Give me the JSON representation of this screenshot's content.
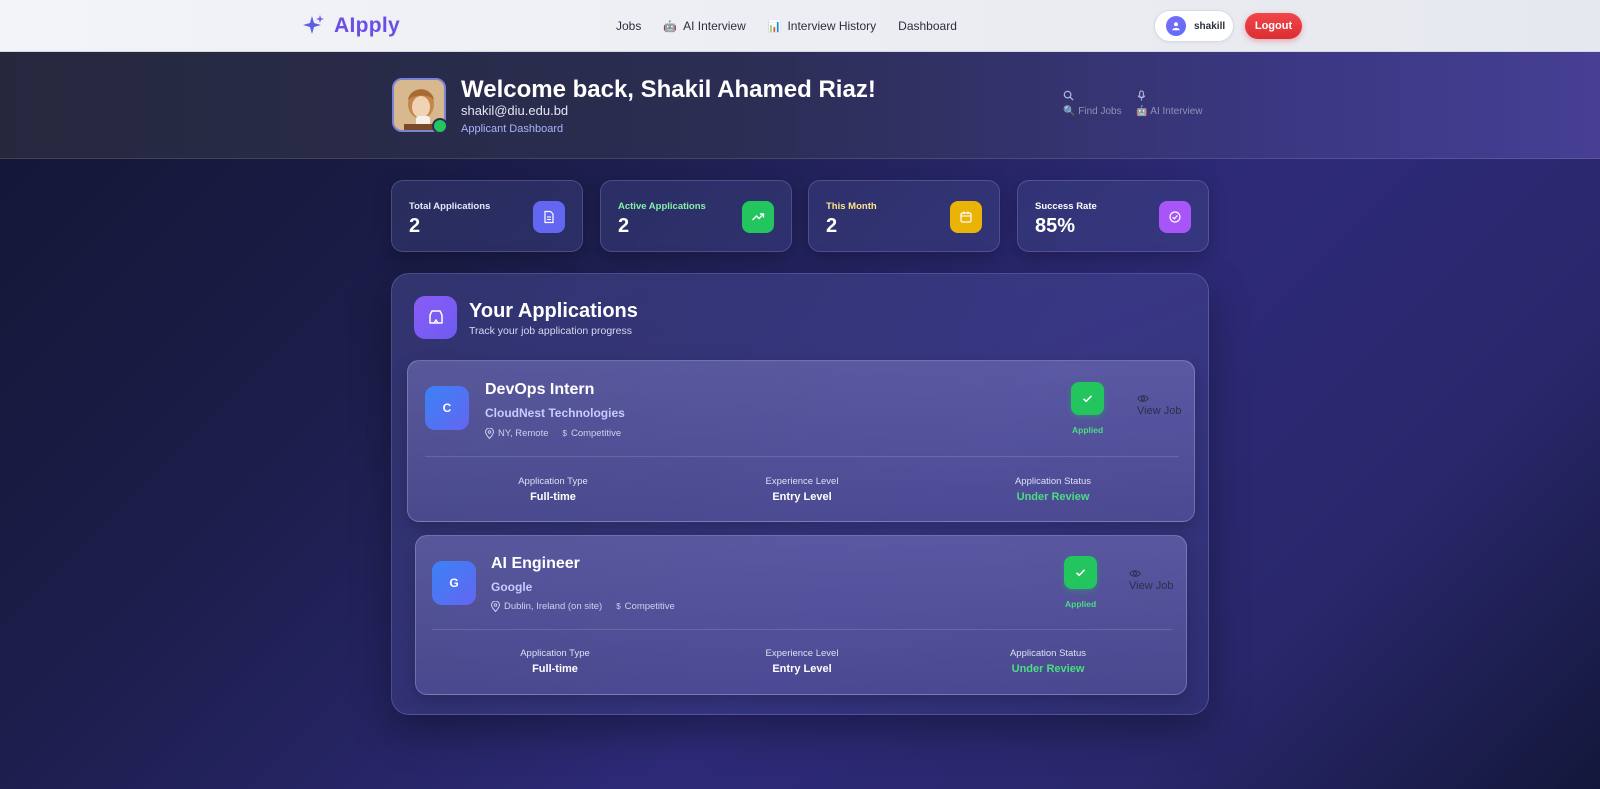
{
  "nav": {
    "brand": "AIpply",
    "links": [
      {
        "label": "Jobs",
        "icon": ""
      },
      {
        "label": "AI Interview",
        "icon": "robot-icon"
      },
      {
        "label": "Interview History",
        "icon": "chart-icon"
      },
      {
        "label": "Dashboard",
        "icon": ""
      }
    ],
    "username": "shakill",
    "logout_label": "Logout"
  },
  "header": {
    "welcome": "Welcome back, Shakil Ahamed Riaz!",
    "email": "shakil@diu.edu.bd",
    "role": "Applicant Dashboard",
    "quick_links": [
      {
        "label": "Find Jobs",
        "icon": "search-icon"
      },
      {
        "label": "AI Interview",
        "icon": "microphone-icon"
      }
    ]
  },
  "stats": [
    {
      "label": "Total Applications",
      "value": "2",
      "color": "#6366f1",
      "label_color": "#e6e8ff",
      "icon": "document-icon"
    },
    {
      "label": "Active Applications",
      "value": "2",
      "color": "#22c55e",
      "label_color": "#86efac",
      "icon": "trending-up-icon"
    },
    {
      "label": "This Month",
      "value": "2",
      "color": "#eab308",
      "label_color": "#fde68a",
      "icon": "calendar-icon"
    },
    {
      "label": "Success Rate",
      "value": "85%",
      "color": "#a855f7",
      "label_color": "#ffffff",
      "icon": "check-circle-icon"
    }
  ],
  "applications_panel": {
    "title": "Your Applications",
    "subtitle": "Track your job application progress",
    "detail_labels": {
      "type": "Application Type",
      "experience": "Experience Level",
      "status": "Application Status"
    },
    "view_label": "View Job",
    "applications": [
      {
        "badge": "C",
        "title": "DevOps Intern",
        "company": "CloudNest Technologies",
        "location": "NY, Remote",
        "salary": "Competitive",
        "status_badge": "Applied",
        "type": "Full-time",
        "experience": "Entry Level",
        "status": "Under Review"
      },
      {
        "badge": "G",
        "title": "AI Engineer",
        "company": "Google",
        "location": "Dublin, Ireland (on site)",
        "salary": "Competitive",
        "status_badge": "Applied",
        "type": "Full-time",
        "experience": "Entry Level",
        "status": "Under Review"
      }
    ]
  }
}
